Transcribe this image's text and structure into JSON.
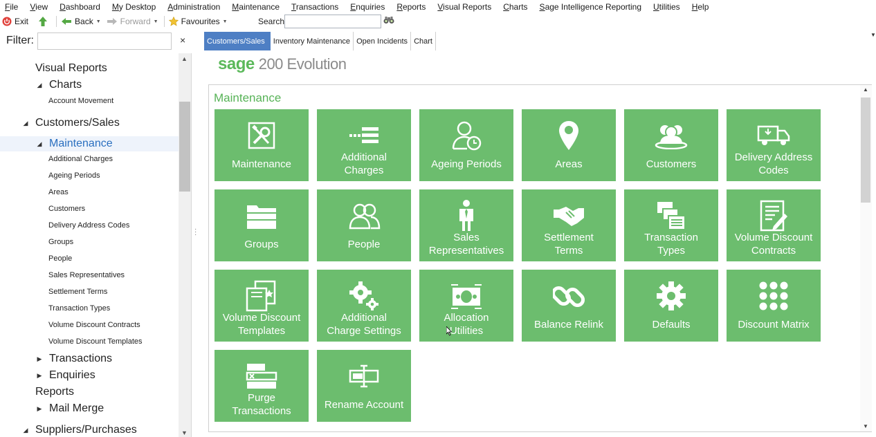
{
  "menu": [
    {
      "label": "File",
      "u": "F",
      "rest": "ile"
    },
    {
      "label": "View",
      "u": "V",
      "rest": "iew"
    },
    {
      "label": "Dashboard",
      "u": "D",
      "rest": "ashboard"
    },
    {
      "label": "My Desktop",
      "u": "M",
      "rest": "y Desktop"
    },
    {
      "label": "Administration",
      "u": "A",
      "rest": "dministration"
    },
    {
      "label": "Maintenance",
      "u": "M",
      "rest": "aintenance"
    },
    {
      "label": "Transactions",
      "u": "T",
      "rest": "ransactions"
    },
    {
      "label": "Enquiries",
      "u": "E",
      "rest": "nquiries"
    },
    {
      "label": "Reports",
      "u": "R",
      "rest": "eports"
    },
    {
      "label": "Visual Reports",
      "u": "V",
      "rest": "isual Reports"
    },
    {
      "label": "Charts",
      "u": "C",
      "rest": "harts"
    },
    {
      "label": "Sage Intelligence Reporting",
      "u": "S",
      "rest": "age Intelligence Reporting"
    },
    {
      "label": "Utilities",
      "u": "U",
      "rest": "tilities"
    },
    {
      "label": "Help",
      "u": "H",
      "rest": "elp"
    }
  ],
  "toolbar": {
    "exit": "Exit",
    "back": "Back",
    "forward": "Forward",
    "favourites": "Favourites",
    "search_label": "Search",
    "search_value": ""
  },
  "filter": {
    "label": "Filter:",
    "value": "",
    "clear": "×"
  },
  "tabs": [
    "Customers/Sales",
    "Inventory Maintenance",
    "Open Incidents",
    "Chart"
  ],
  "active_tab": 0,
  "sidebar": [
    {
      "label": "Visual Reports",
      "level": 0,
      "arrow": ""
    },
    {
      "label": "Charts",
      "level": 1,
      "arrow": "open"
    },
    {
      "label": "Account Movement",
      "level": 2,
      "arrow": ""
    },
    {
      "label": "Customers/Sales",
      "level": 0,
      "arrow": "open"
    },
    {
      "label": "Maintenance",
      "level": 1,
      "arrow": "open",
      "selected": true
    },
    {
      "label": "Additional Charges",
      "level": 2,
      "arrow": ""
    },
    {
      "label": "Ageing Periods",
      "level": 2,
      "arrow": ""
    },
    {
      "label": "Areas",
      "level": 2,
      "arrow": ""
    },
    {
      "label": "Customers",
      "level": 2,
      "arrow": ""
    },
    {
      "label": "Delivery Address Codes",
      "level": 2,
      "arrow": ""
    },
    {
      "label": "Groups",
      "level": 2,
      "arrow": ""
    },
    {
      "label": "People",
      "level": 2,
      "arrow": ""
    },
    {
      "label": "Sales Representatives",
      "level": 2,
      "arrow": ""
    },
    {
      "label": "Settlement Terms",
      "level": 2,
      "arrow": ""
    },
    {
      "label": "Transaction Types",
      "level": 2,
      "arrow": ""
    },
    {
      "label": "Volume Discount Contracts",
      "level": 2,
      "arrow": ""
    },
    {
      "label": "Volume Discount Templates",
      "level": 2,
      "arrow": ""
    },
    {
      "label": "Transactions",
      "level": 1,
      "arrow": "closed"
    },
    {
      "label": "Enquiries",
      "level": 1,
      "arrow": "closed"
    },
    {
      "label": "Reports",
      "level": 0,
      "arrow": ""
    },
    {
      "label": "Mail Merge",
      "level": 1,
      "arrow": "closed"
    },
    {
      "label": "Suppliers/Purchases",
      "level": 0,
      "arrow": "open"
    }
  ],
  "logo": {
    "brand": "sage",
    "product": "200 Evolution"
  },
  "panel": {
    "title": "Maintenance"
  },
  "tiles": [
    {
      "label": "Maintenance",
      "icon": "tools-icon"
    },
    {
      "label": "Additional\nCharges",
      "icon": "charges-icon"
    },
    {
      "label": "Ageing Periods",
      "icon": "person-clock-icon"
    },
    {
      "label": "Areas",
      "icon": "map-pin-icon"
    },
    {
      "label": "Customers",
      "icon": "customers-icon"
    },
    {
      "label": "Delivery Address\nCodes",
      "icon": "delivery-truck-icon"
    },
    {
      "label": "Groups",
      "icon": "folders-icon"
    },
    {
      "label": "People",
      "icon": "people-icon"
    },
    {
      "label": "Sales\nRepresentatives",
      "icon": "sales-rep-icon"
    },
    {
      "label": "Settlement\nTerms",
      "icon": "handshake-icon"
    },
    {
      "label": "Transaction\nTypes",
      "icon": "documents-stack-icon"
    },
    {
      "label": "Volume Discount\nContracts",
      "icon": "contract-icon"
    },
    {
      "label": "Volume Discount\nTemplates",
      "icon": "templates-icon"
    },
    {
      "label": "Additional\nCharge Settings",
      "icon": "gears-icon"
    },
    {
      "label": "Allocation\nUtilities",
      "icon": "cash-icon"
    },
    {
      "label": "Balance Relink",
      "icon": "chain-link-icon"
    },
    {
      "label": "Defaults",
      "icon": "gear-icon"
    },
    {
      "label": "Discount Matrix",
      "icon": "dots-grid-icon"
    },
    {
      "label": "Purge\nTransactions",
      "icon": "purge-icon"
    },
    {
      "label": "Rename Account",
      "icon": "rename-icon"
    }
  ],
  "colors": {
    "tile": "#6cbd6e",
    "accent_green": "#57b357",
    "tab_active": "#4e7fc4",
    "selected_text": "#2a6fbf"
  }
}
